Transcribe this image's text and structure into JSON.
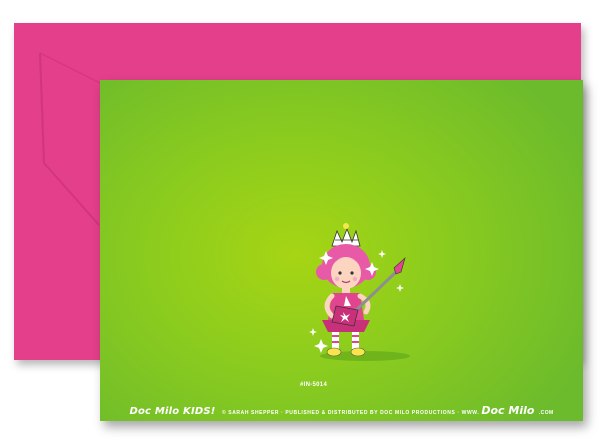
{
  "card": {
    "sku": "#IN-5014",
    "brand_name": "Doc Milo KIDS!",
    "credit_line": "© SARAH SHEPPER · PUBLISHED & DISTRIBUTED BY DOC MILO PRODUCTIONS · WWW.",
    "site_logo": "Doc Milo",
    "site_suffix": ".COM"
  },
  "colors": {
    "envelope": "#e33f8b",
    "card_center": "#a6d514",
    "card_edge": "#6cbb2c"
  }
}
